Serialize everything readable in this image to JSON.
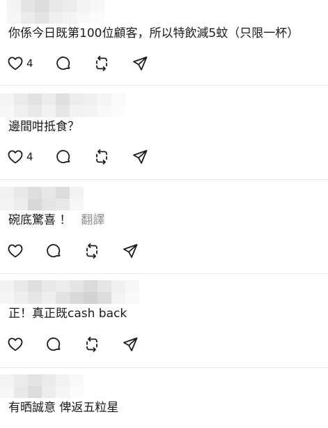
{
  "colors": {
    "text": "#1a1a1a",
    "muted": "#8e8e8e",
    "divider": "#e6e6e6",
    "icon": "#1a1a1a"
  },
  "replies": [
    {
      "username": "blurred",
      "text": "你係今日既第100位顧客，所以特飲減5蚊（只限一杯）",
      "likes": "4",
      "translate": ""
    },
    {
      "username": "blurred",
      "text": "邊間咁抵食？",
      "likes": "4",
      "translate": ""
    },
    {
      "username": "blurred",
      "text": "碗底驚喜 ！",
      "likes": "",
      "translate": "翻譯"
    },
    {
      "username": "blurred",
      "text": "正！真正既cash back",
      "likes": "",
      "translate": ""
    },
    {
      "username": "blurred",
      "text": "有晒誠意 俾返五粒星",
      "likes": "",
      "translate": ""
    }
  ],
  "icons": {
    "like": "heart-icon",
    "comment": "comment-icon",
    "repost": "repost-icon",
    "share": "share-icon"
  }
}
